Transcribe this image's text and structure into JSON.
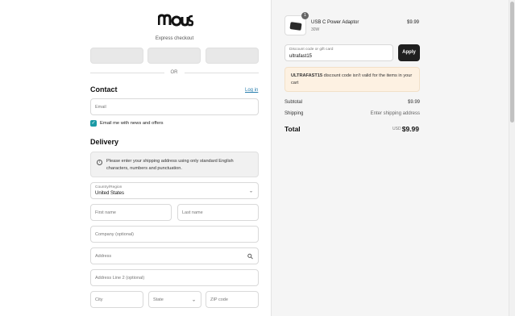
{
  "brand": {
    "logo_text": "MOUS"
  },
  "express": {
    "label": "Express checkout",
    "buttons": [
      "",
      "",
      ""
    ]
  },
  "divider": {
    "or": "OR"
  },
  "contact": {
    "title": "Contact",
    "login": "Log in",
    "email_placeholder": "Email",
    "news_checkbox": {
      "label": "Email me with news and offers",
      "checked": true
    }
  },
  "delivery": {
    "title": "Delivery",
    "notice": "Please enter your shipping address using only standard English characters, numbers and punctuation.",
    "country": {
      "label": "Country/Region",
      "value": "United States"
    },
    "first_name": "First name",
    "last_name": "Last name",
    "company": "Company (optional)",
    "address": "Address",
    "address2": "Address Line 2 (optional)",
    "city": "City",
    "state": "State",
    "zip": "ZIP code"
  },
  "order": {
    "item": {
      "name": "USB C Power Adaptor",
      "variant": "30W",
      "price": "$9.99",
      "quantity": "1"
    },
    "discount": {
      "label": "Discount code or gift card",
      "value": "ultrafast15",
      "apply": "Apply"
    },
    "alert": {
      "code": "ULTRAFAST15",
      "message": " discount code isn't valid for the items in your cart"
    },
    "subtotal_label": "Subtotal",
    "subtotal_value": "$9.99",
    "shipping_label": "Shipping",
    "shipping_value": "Enter shipping address",
    "total_label": "Total",
    "currency": "USD",
    "total_value": "$9.99"
  },
  "colors": {
    "accent": "#1a9aa5",
    "link": "#2a7fae",
    "alert_bg": "#fdf1e2",
    "button_dark": "#1f1f1f"
  }
}
